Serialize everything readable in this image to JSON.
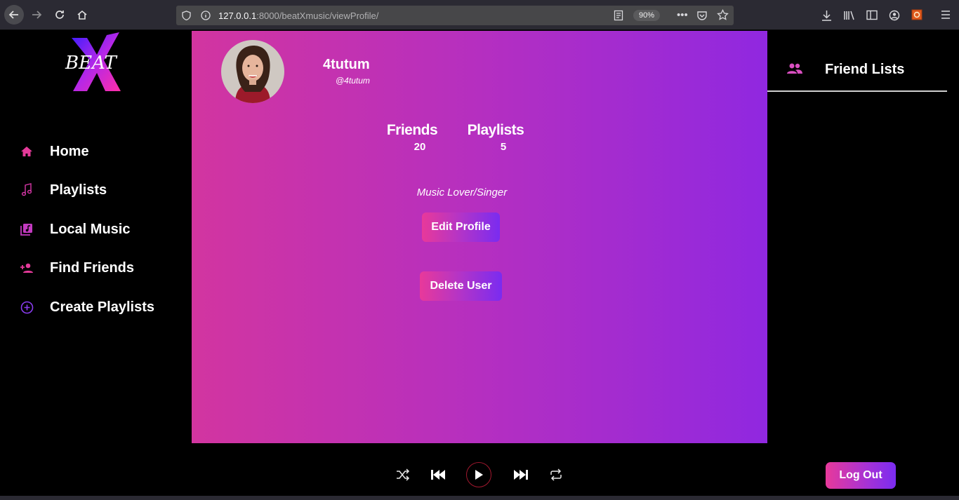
{
  "browser": {
    "url_host": "127.0.0.1",
    "url_path": ":8000/beatXmusic/viewProfile/",
    "zoom": "90%"
  },
  "logo": {
    "text": "BEAT"
  },
  "sidebar": {
    "items": [
      {
        "label": "Home",
        "icon": "home-icon"
      },
      {
        "label": "Playlists",
        "icon": "music-note-icon"
      },
      {
        "label": "Local Music",
        "icon": "music-library-icon"
      },
      {
        "label": "Find Friends",
        "icon": "person-add-icon"
      },
      {
        "label": "Create Playlists",
        "icon": "add-circle-icon"
      }
    ]
  },
  "profile": {
    "username": "4tutum",
    "handle": "@4tutum",
    "friends_label": "Friends",
    "friends_count": "20",
    "playlists_label": "Playlists",
    "playlists_count": "5",
    "bio": "Music Lover/Singer",
    "edit_label": "Edit Profile",
    "delete_label": "Delete User"
  },
  "right_panel": {
    "title": "Friend Lists",
    "icon": "group-icon"
  },
  "player": {
    "controls": [
      "shuffle-icon",
      "previous-icon",
      "play-icon",
      "next-icon",
      "repeat-icon"
    ],
    "logout_label": "Log Out"
  },
  "colors": {
    "gradient_start": "#d235a0",
    "gradient_end": "#9028e0",
    "accent_pink": "#e8399a",
    "accent_purple": "#7a2cf0"
  }
}
